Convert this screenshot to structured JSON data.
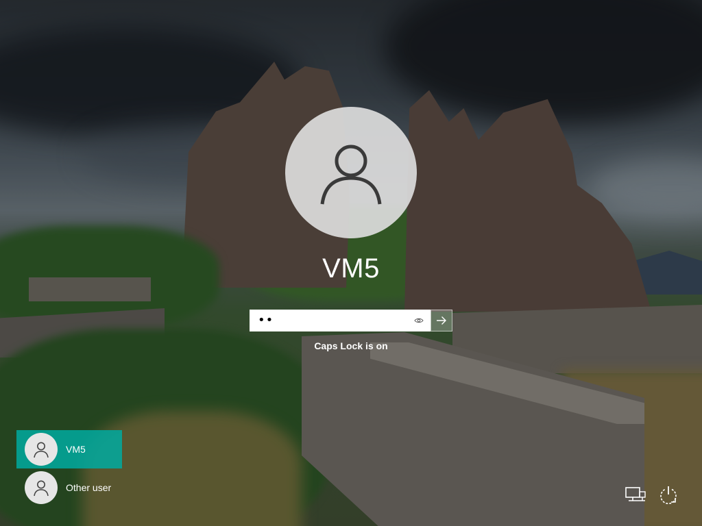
{
  "login": {
    "username": "VM5",
    "password_masked": "••",
    "caps_lock_message": "Caps Lock is on"
  },
  "users": [
    {
      "label": "VM5",
      "selected": true
    },
    {
      "label": "Other user",
      "selected": false
    }
  ],
  "icons": {
    "avatar": "person-icon",
    "reveal": "eye-icon",
    "submit": "arrow-right-icon",
    "network": "network-icon",
    "power": "power-icon"
  },
  "colors": {
    "selected_user_bg": "#00aaa0",
    "password_field_bg": "#ffffff",
    "text": "#ffffff"
  }
}
